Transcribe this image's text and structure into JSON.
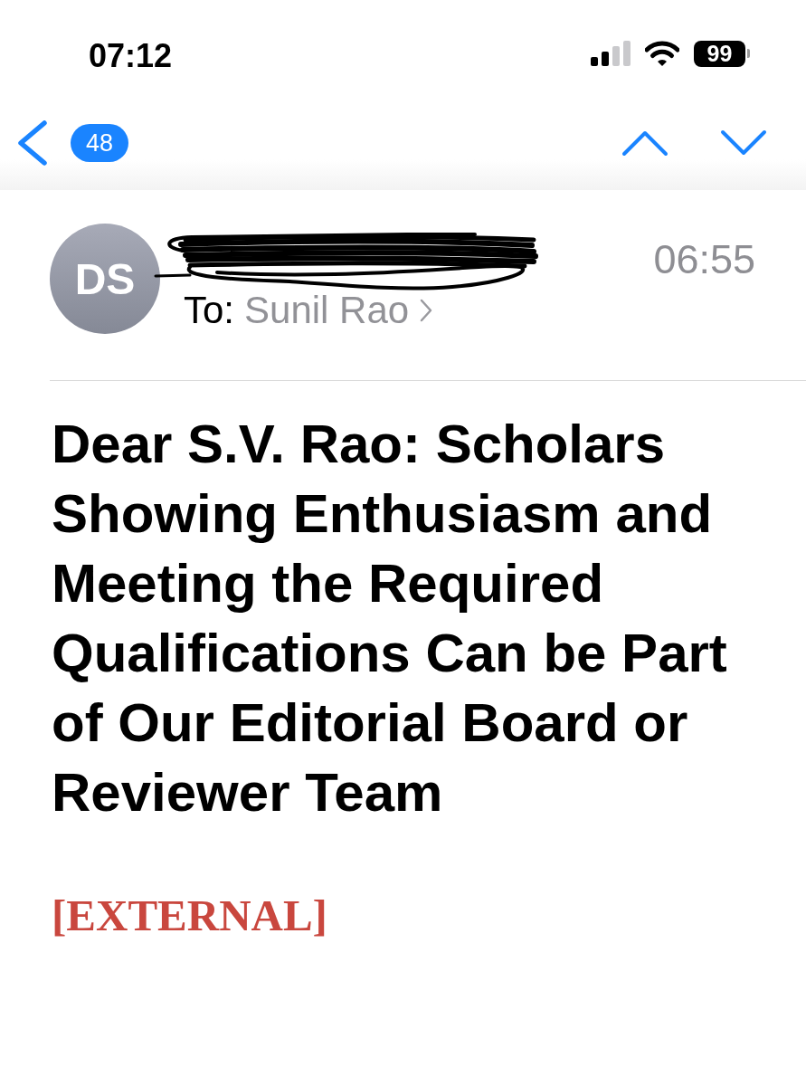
{
  "status_bar": {
    "time": "07:12",
    "battery": "99"
  },
  "navigation": {
    "unread_count": "48"
  },
  "message": {
    "sender": {
      "initials": "DS",
      "redacted": true
    },
    "time": "06:55",
    "recipient_label": "To:",
    "recipient": "Sunil Rao",
    "subject": "Dear S.V. Rao: Scholars Showing Enthusiasm and Meeting the Required Qualifications Can be Part of Our Editorial Board or Reviewer Team",
    "body": {
      "external_tag": "[EXTERNAL]"
    }
  }
}
